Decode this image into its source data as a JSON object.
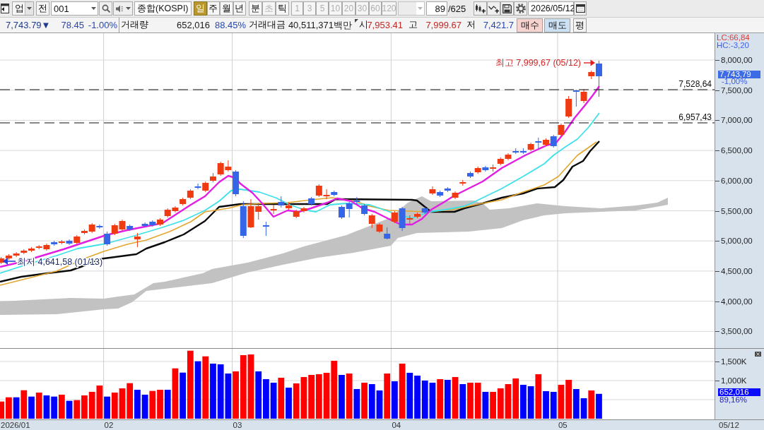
{
  "toolbar": {
    "market": {
      "value": "업"
    },
    "all_button": {
      "label": "전"
    },
    "code_field": {
      "value": "001"
    },
    "name_field": {
      "value": "종합(KOSPI)"
    },
    "periods": [
      {
        "label": "일",
        "selected": true,
        "disabled": false
      },
      {
        "label": "주",
        "selected": false,
        "disabled": false
      },
      {
        "label": "월",
        "selected": false,
        "disabled": false
      },
      {
        "label": "년",
        "selected": false,
        "disabled": false
      }
    ],
    "intraday_periods": [
      {
        "label": "분",
        "selected": false,
        "disabled": false
      },
      {
        "label": "초",
        "selected": false,
        "disabled": true
      },
      {
        "label": "틱",
        "selected": false,
        "disabled": false
      }
    ],
    "intervals": [
      {
        "label": "1",
        "disabled": true
      },
      {
        "label": "3",
        "disabled": true
      },
      {
        "label": "5",
        "disabled": true
      },
      {
        "label": "10",
        "disabled": true
      },
      {
        "label": "20",
        "disabled": true
      },
      {
        "label": "30",
        "disabled": true
      },
      {
        "label": "60",
        "disabled": true
      },
      {
        "label": "120",
        "disabled": true
      }
    ],
    "custom_interval": {
      "disabled": true
    },
    "bar_count": {
      "value": "89",
      "total": "/625"
    },
    "date_field": {
      "value": "2026/05/12"
    }
  },
  "quote_bar": {
    "fields": [
      {
        "kind": "value",
        "text": "7,743.79▼",
        "color": "#1f3a8e"
      },
      {
        "kind": "value",
        "text": "78.45",
        "color": "#2848ae"
      },
      {
        "kind": "value",
        "text": "-1.00%",
        "color": "#2848ae"
      },
      {
        "kind": "label",
        "text": "거래량"
      },
      {
        "kind": "value",
        "text": "652,016",
        "color": "#1a1a1a"
      },
      {
        "kind": "value",
        "text": "88.45%",
        "color": "#2848ae"
      },
      {
        "kind": "label",
        "text": "거래대금"
      },
      {
        "kind": "value",
        "text": "40,511,371백만",
        "color": "#1a1a1a"
      },
      {
        "kind": "label",
        "text": "시"
      },
      {
        "kind": "value",
        "text": "7,953.41",
        "color": "#c42a26"
      },
      {
        "kind": "label",
        "text": "고"
      },
      {
        "kind": "value",
        "text": "7,999.67",
        "color": "#c42a26"
      },
      {
        "kind": "label",
        "text": "저"
      },
      {
        "kind": "value",
        "text": "7,421.7",
        "color": "#2848ae"
      }
    ],
    "buttons": [
      {
        "label": "매수",
        "kind": "buy"
      },
      {
        "label": "매도",
        "kind": "sell"
      },
      {
        "label": "평",
        "kind": "plain"
      }
    ]
  },
  "chart": {
    "indicators": [
      {
        "text": "LC:66,84",
        "color": "#e23c32"
      },
      {
        "text": "HC:-3,20",
        "color": "#3f5fe6"
      }
    ],
    "price_axis": {
      "ticks": [
        "8,000,00",
        "7,500,00",
        "7,000,00",
        "6,500,00",
        "6,000,00",
        "5,500,00",
        "5,000,00",
        "4,500,00",
        "4,000,00",
        "3,500,00"
      ],
      "current_price": "7,743,79",
      "current_change": "-1,00%"
    },
    "levels": [
      {
        "label": "7,528,64"
      },
      {
        "label": "6,957,43"
      }
    ],
    "high_marker": {
      "text": "최고 7,999,67 (05/12)"
    },
    "low_marker": {
      "text": "최저 4,641,58 (01/13)"
    },
    "volume_axis": {
      "ticks": [
        "1,500K",
        "1,000K"
      ],
      "current_volume": "652,016",
      "current_ratio": "89,16%"
    },
    "x_axis": {
      "labels": [
        "2026/01",
        "02",
        "03",
        "04",
        "05"
      ],
      "last_date": "05/12"
    }
  }
}
